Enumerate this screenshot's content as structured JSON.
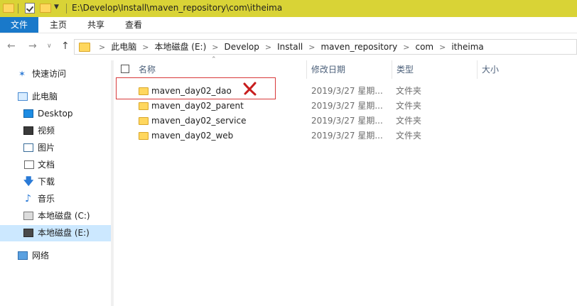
{
  "window": {
    "title": "E:\\Develop\\Install\\maven_repository\\com\\itheima",
    "titlebar_color": "#d9d336"
  },
  "ribbon": {
    "tabs": [
      "文件",
      "主页",
      "共享",
      "查看"
    ],
    "file_tab_color": "#1979ca"
  },
  "nav": {
    "back_icon": "arrow-left-icon",
    "forward_icon": "arrow-right-icon",
    "recent_icon": "chevron-down-icon",
    "up_icon": "arrow-up-icon",
    "breadcrumbs": [
      "此电脑",
      "本地磁盘 (E:)",
      "Develop",
      "Install",
      "maven_repository",
      "com",
      "itheima"
    ]
  },
  "sidebar": {
    "items": [
      {
        "label": "快速访问",
        "icon": "star-icon"
      },
      {
        "label": "此电脑",
        "icon": "computer-icon"
      },
      {
        "label": "Desktop",
        "icon": "desktop-icon"
      },
      {
        "label": "视频",
        "icon": "video-icon"
      },
      {
        "label": "图片",
        "icon": "pictures-icon"
      },
      {
        "label": "文档",
        "icon": "documents-icon"
      },
      {
        "label": "下载",
        "icon": "download-icon"
      },
      {
        "label": "音乐",
        "icon": "music-icon"
      },
      {
        "label": "本地磁盘 (C:)",
        "icon": "drive-icon"
      },
      {
        "label": "本地磁盘 (E:)",
        "icon": "drive-icon",
        "selected": true
      },
      {
        "label": "网络",
        "icon": "network-icon"
      }
    ],
    "selected_color": "#cce8ff"
  },
  "columns": {
    "name": "名称",
    "modified": "修改日期",
    "type": "类型",
    "size": "大小"
  },
  "files": [
    {
      "name": "maven_day02_dao",
      "modified": "2019/3/27 星期...",
      "type": "文件夹"
    },
    {
      "name": "maven_day02_parent",
      "modified": "2019/3/27 星期...",
      "type": "文件夹"
    },
    {
      "name": "maven_day02_service",
      "modified": "2019/3/27 星期...",
      "type": "文件夹"
    },
    {
      "name": "maven_day02_web",
      "modified": "2019/3/27 星期...",
      "type": "文件夹"
    }
  ],
  "annotation": {
    "highlight_color": "#d8393a",
    "mark_icon": "red-x-icon"
  }
}
